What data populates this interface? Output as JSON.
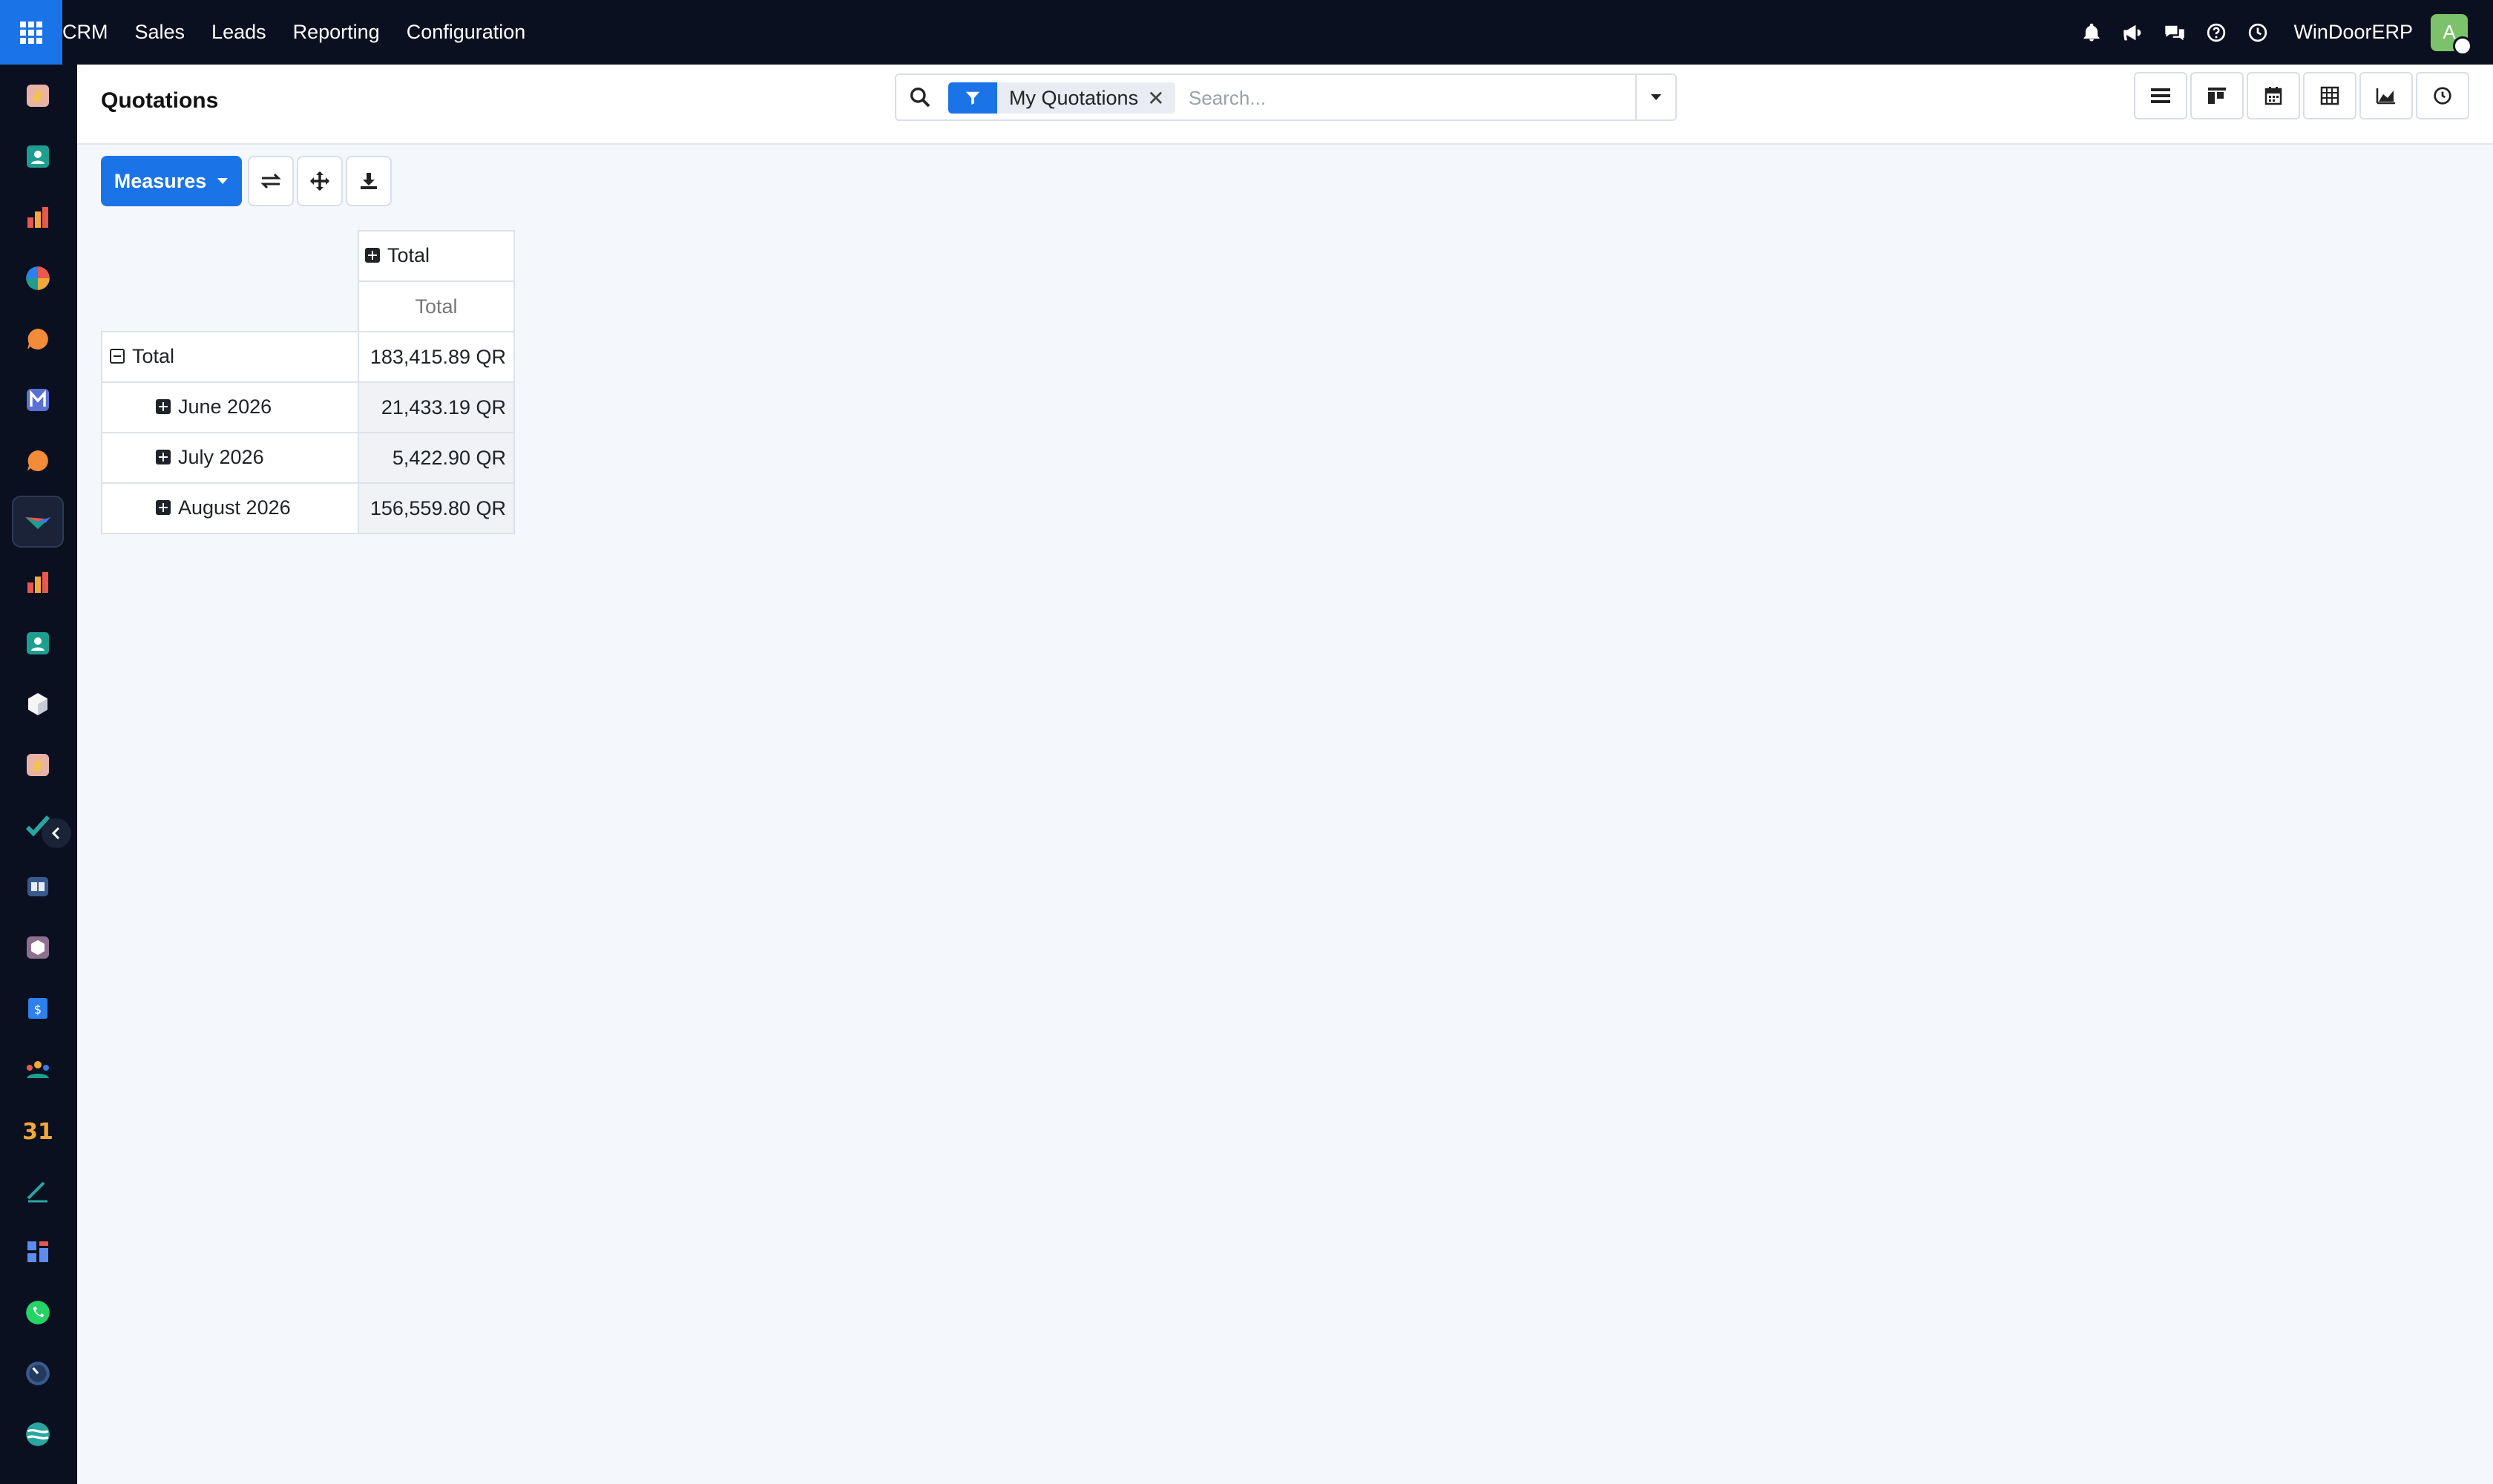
{
  "topbar": {
    "menu": [
      "CRM",
      "Sales",
      "Leads",
      "Reporting",
      "Configuration"
    ],
    "company": "WinDoorERP",
    "avatar_letter": "A",
    "icons": [
      "bell-icon",
      "megaphone-icon",
      "chat-icon",
      "help-icon",
      "clock-icon"
    ]
  },
  "sidebar": {
    "apps": [
      "discuss-app-icon",
      "contacts-app-icon",
      "reporting-app-icon",
      "dashboard-app-icon",
      "livechat-app-icon",
      "email-marketing-app-icon",
      "chat-app-icon",
      "crm-app-icon",
      "sales-app-icon",
      "employees-app-icon",
      "inventory-app-icon",
      "tools-app-icon",
      "project-app-icon",
      "knowledge-app-icon",
      "packaging-app-icon",
      "invoicing-app-icon",
      "team-app-icon",
      "calendar-app-icon",
      "sign-app-icon",
      "website-app-icon",
      "whatsapp-app-icon",
      "timer-app-icon",
      "odoo-app-icon"
    ],
    "active_index": 7
  },
  "control": {
    "title": "Quotations",
    "facet": "My Quotations",
    "search_placeholder": "Search...",
    "views": [
      "list-view-icon",
      "kanban-view-icon",
      "calendar-view-icon",
      "pivot-view-icon",
      "graph-view-icon",
      "activity-view-icon"
    ]
  },
  "toolbar": {
    "measures_label": "Measures",
    "buttons": [
      "flip-axis-icon",
      "expand-all-icon",
      "download-icon"
    ]
  },
  "pivot": {
    "col_header": "Total",
    "measure_header": "Total",
    "rows": [
      {
        "label": "Total",
        "value": "183,415.89 QR",
        "level": 0,
        "expanded": true
      },
      {
        "label": "June 2026",
        "value": "21,433.19 QR",
        "level": 1,
        "expanded": false
      },
      {
        "label": "July 2026",
        "value": "5,422.90 QR",
        "level": 1,
        "expanded": false
      },
      {
        "label": "August 2026",
        "value": "156,559.80 QR",
        "level": 1,
        "expanded": false
      }
    ]
  },
  "colors": {
    "navbar": "#0b1020",
    "accent": "#1b73e8",
    "background": "#f4f7fb"
  }
}
